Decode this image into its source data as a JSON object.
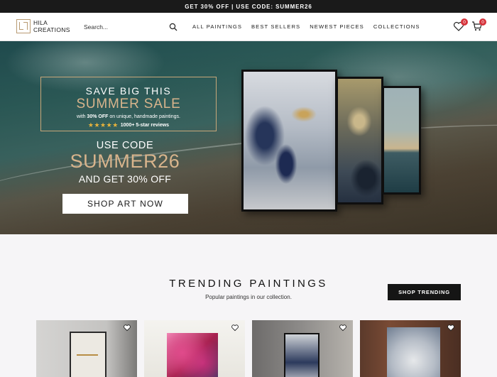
{
  "announcement": "GET 30% OFF | USE CODE: SUMMER26",
  "header": {
    "logo_line1": "HILA",
    "logo_line2": "CREATIONS",
    "search_placeholder": "Search...",
    "nav": [
      "ALL PAINTINGS",
      "BEST SELLERS",
      "NEWEST PIECES",
      "COLLECTIONS"
    ],
    "wishlist_count": "0",
    "cart_count": "0"
  },
  "hero": {
    "promo_line1": "SAVE BIG THIS",
    "promo_line2": "SUMMER SALE",
    "promo_with": "with",
    "promo_off": "30% OFF",
    "promo_rest": "on unique, handmade paintings.",
    "stars": "★★★★★",
    "reviews": "1000+ 5-star reviews",
    "code_label": "USE CODE",
    "code_value": "SUMMER26",
    "code_sub": "AND GET 30% OFF",
    "cta": "SHOP ART NOW"
  },
  "trending": {
    "title": "TRENDING PAINTINGS",
    "subtitle": "Popular paintings in our collection.",
    "button": "SHOP TRENDING"
  },
  "colors": {
    "accent_gold": "#d8b48c",
    "badge_red": "#d6333b",
    "dark": "#151515"
  }
}
